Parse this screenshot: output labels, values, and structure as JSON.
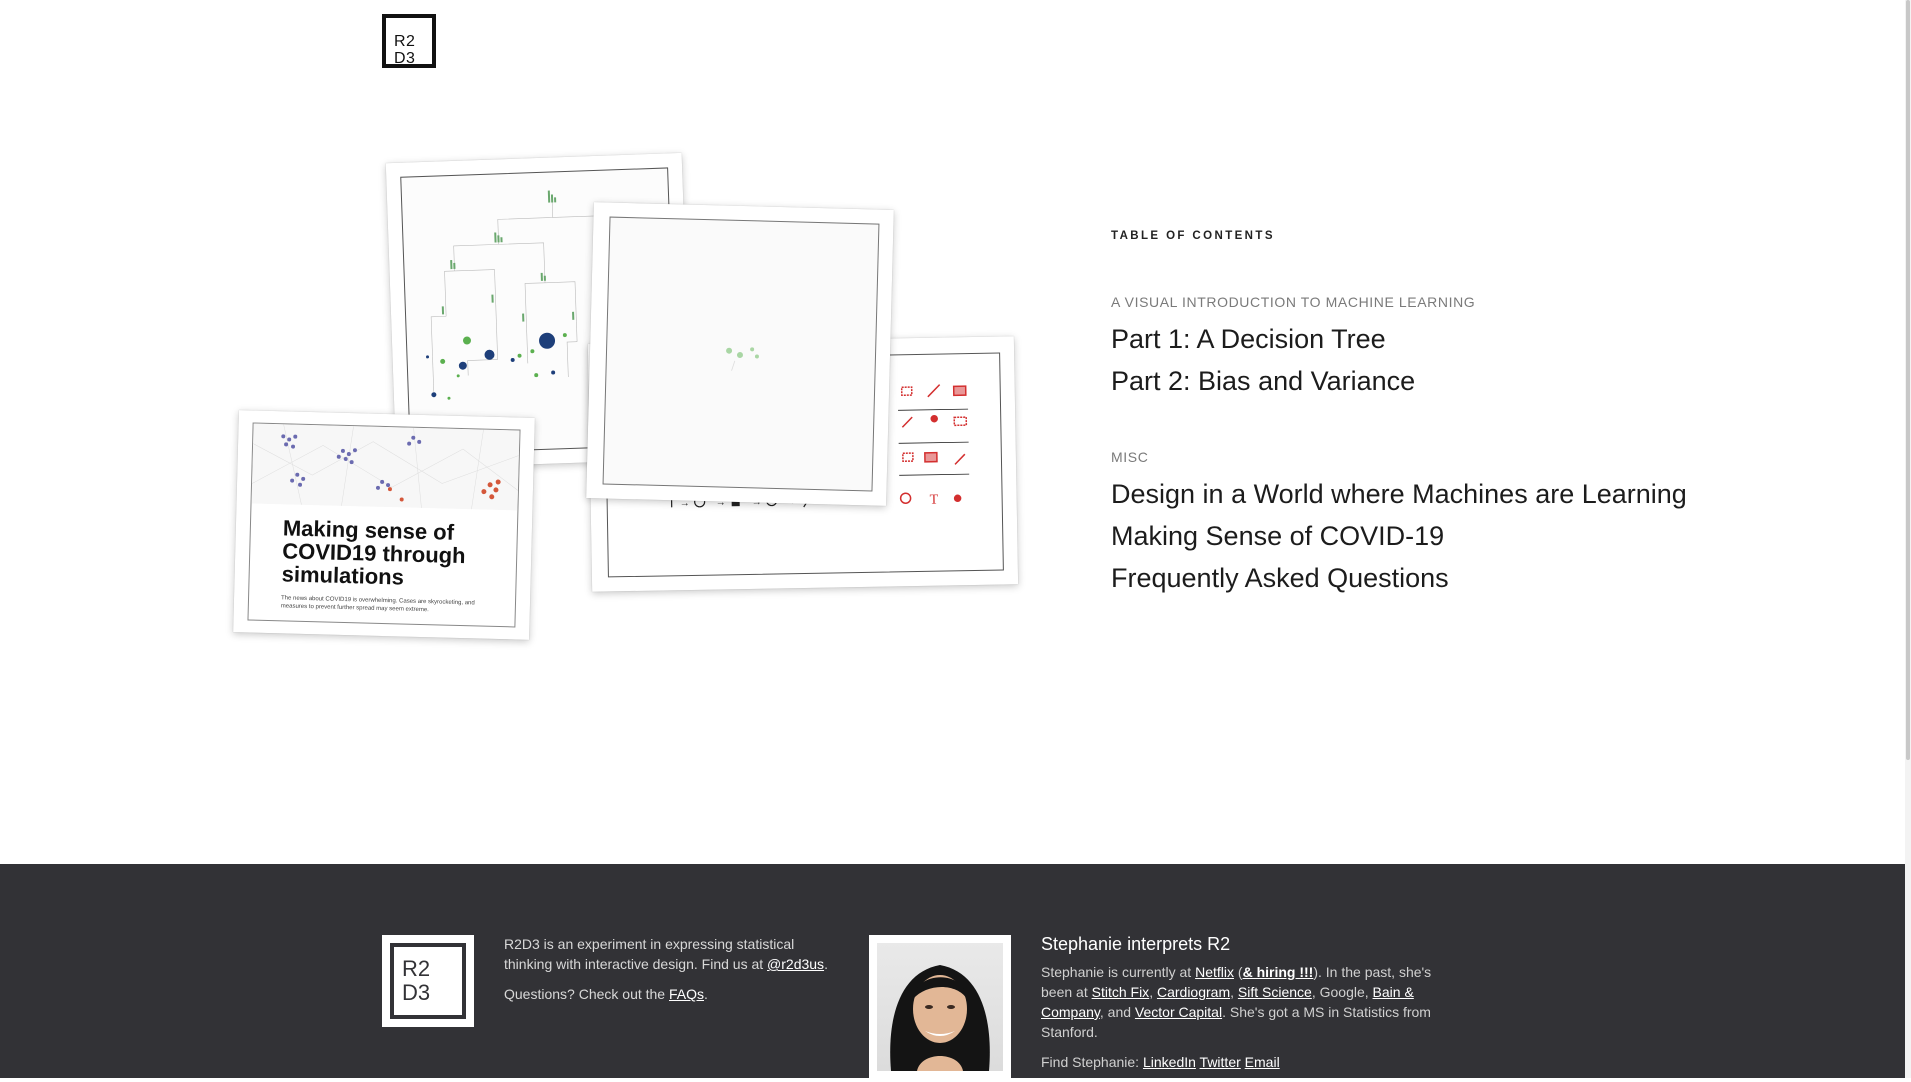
{
  "header": {
    "logo_line1": "R2",
    "logo_line2": "D3"
  },
  "covid_card": {
    "title_line1": "Making sense of",
    "title_line2": "COVID19 through",
    "title_line3": "simulations",
    "blurb_line1": "The news about COVID19 is overwhelming. Cases are skyrocketing, and",
    "blurb_line2": "measures to prevent further spread may seem extreme."
  },
  "toc": {
    "heading": "TABLE OF CONTENTS",
    "sections": [
      {
        "title": "A VISUAL INTRODUCTION TO MACHINE LEARNING",
        "links": [
          "Part 1: A Decision Tree",
          "Part 2: Bias and Variance"
        ]
      },
      {
        "title": "MISC",
        "links": [
          "Design in a World where Machines are Learning",
          "Making Sense of COVID-19",
          "Frequently Asked Questions"
        ]
      }
    ]
  },
  "footer": {
    "logo_line1": "R2",
    "logo_line2": "D3",
    "about_text": "R2D3 is an experiment in expressing statistical thinking with interactive design. Find us at",
    "about_handle": "@r2d3us",
    "questions_text": "Questions? Check out the",
    "faqs_link": "FAQs",
    "bio_title": "Stephanie interprets R2",
    "bio_p1_a": "Stephanie is currently at",
    "netflix": "Netflix",
    "hiring": "& hiring !!!",
    "bio_p1_b": ". In the past, she's been at",
    "stitch_fix": "Stitch Fix",
    "cardiogram": "Cardiogram",
    "sift": "Sift Science",
    "google": ", Google,",
    "bain": "Bain & Company",
    "and": ", and",
    "vector": "Vector Capital",
    "bio_p1_c": ". She's got a MS in Statistics from Stanford.",
    "find_label": "Find Stephanie:",
    "linkedin": "LinkedIn",
    "twitter": "Twitter",
    "email": "Email"
  },
  "colors": {
    "footer_bg": "#323236",
    "green": "#4caf50",
    "navy": "#1e3f7a",
    "red": "#d32f2f"
  }
}
